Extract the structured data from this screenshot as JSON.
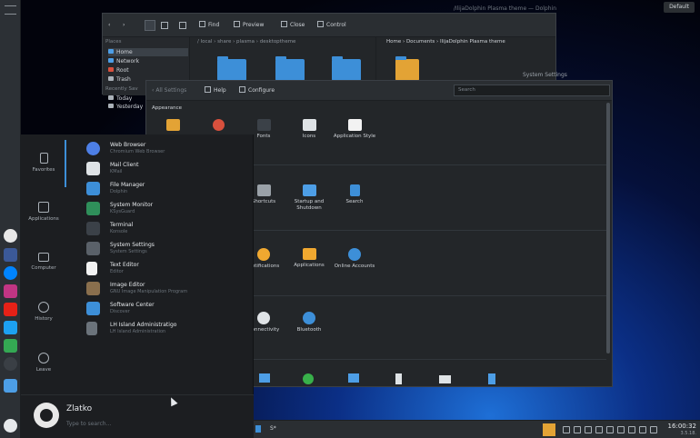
{
  "desktop": {
    "badge": "Default"
  },
  "dolphin": {
    "title": "/IlijaDolphin Plasma theme — Dolphin",
    "toolbar": [
      "Find",
      "Preview",
      "Close",
      "Control"
    ],
    "places_header": "Places",
    "places": [
      "Home",
      "Network",
      "Root",
      "Trash"
    ],
    "recent_header": "Recently Sav",
    "recent": [
      "Today",
      "Yesterday"
    ],
    "breadcrumb_left": "/ local › share › plasma › desktoptheme",
    "breadcrumb_right": "Home › Documents › IlijaDolphin Plasma theme"
  },
  "settings": {
    "title": "System Settings",
    "toolbar": {
      "back": "All Settings",
      "help": "Help",
      "configure": "Configure"
    },
    "search_placeholder": "Search",
    "section": "Appearance",
    "row1": [
      "Fonts",
      "Icons",
      "Application Style"
    ],
    "row2": [
      "Shortcuts",
      "Startup and Shutdown",
      "Search"
    ],
    "row3": [
      "Notifications",
      "Applications",
      "Online Accounts"
    ],
    "row4": [
      "Connectivity",
      "Bluetooth"
    ]
  },
  "launcher": {
    "categories": [
      "Favorites",
      "Applications",
      "Computer",
      "History",
      "Leave"
    ],
    "apps": [
      {
        "name": "Web Browser",
        "desc": "Chromium Web Browser"
      },
      {
        "name": "Mail Client",
        "desc": "KMail"
      },
      {
        "name": "File Manager",
        "desc": "Dolphin"
      },
      {
        "name": "System Monitor",
        "desc": "KSysGuard"
      },
      {
        "name": "Terminal",
        "desc": "Konsole"
      },
      {
        "name": "System Settings",
        "desc": "System Settings"
      },
      {
        "name": "Text Editor",
        "desc": "Editor"
      },
      {
        "name": "Image Editor",
        "desc": "GNU Image Manipulation Program"
      },
      {
        "name": "Software Center",
        "desc": "Discover"
      },
      {
        "name": "LH Island Administratigo",
        "desc": "LH Island Administration"
      }
    ],
    "user": "Zlatko",
    "search_placeholder": "Type to search..."
  },
  "taskbar": {
    "task_label": "S*",
    "time": "16:00:32",
    "date": "3.5.18."
  },
  "colors": {
    "accent": "#3d8fd8",
    "window": "#232629",
    "panel": "#2a2e32"
  }
}
